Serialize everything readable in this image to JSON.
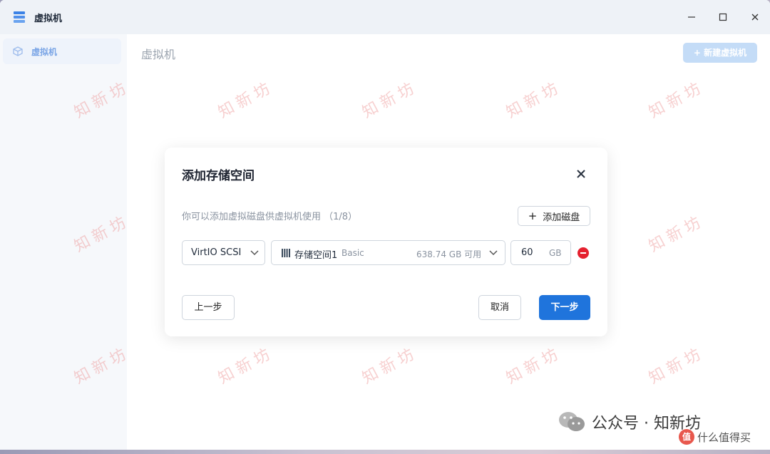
{
  "window": {
    "title": "虚拟机"
  },
  "sidebar": {
    "items": [
      {
        "label": "虚拟机",
        "icon": "cube-icon"
      }
    ]
  },
  "main": {
    "title": "虚拟机",
    "new_button": "+ 新建虚拟机"
  },
  "dialog": {
    "title": "添加存储空间",
    "description": "你可以添加虚拟磁盘供虚拟机使用 （1/8）",
    "add_disk_label": "添加磁盘",
    "disk": {
      "bus": "VirtIO SCSI",
      "pool_name": "存储空间1",
      "pool_type": "Basic",
      "pool_available": "638.74 GB 可用",
      "size_value": "60",
      "size_unit": "GB"
    },
    "prev_button": "上一步",
    "cancel_button": "取消",
    "next_button": "下一步"
  },
  "watermark": {
    "text": "知新坊"
  },
  "footer": {
    "brand_text": "公众号 · 知新坊",
    "site_text": "什么值得买",
    "site_logo_char": "值"
  },
  "colors": {
    "accent": "#1f74dc",
    "danger": "#e5202e"
  }
}
